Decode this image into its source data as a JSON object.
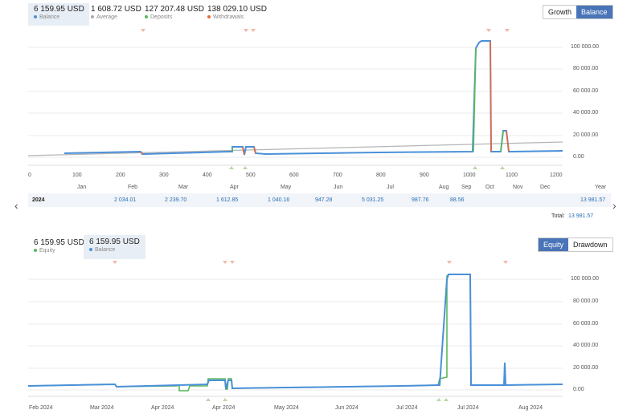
{
  "top_stats": [
    {
      "value": "6 159.95 USD",
      "label": "Balance",
      "color": "#4a90d9"
    },
    {
      "value": "1 608.72 USD",
      "label": "Average",
      "color": "#aaaaaa"
    },
    {
      "value": "127 207.48 USD",
      "label": "Deposits",
      "color": "#5cb85c"
    },
    {
      "value": "138 029.10 USD",
      "label": "Withdrawals",
      "color": "#e8663d"
    }
  ],
  "top_toggle": {
    "growth": "Growth",
    "balance": "Balance",
    "selected": "Balance"
  },
  "chart1": {
    "x_ticks": [
      "0",
      "100",
      "200",
      "300",
      "400",
      "500",
      "600",
      "700",
      "800",
      "900",
      "1000",
      "1100",
      "1200"
    ],
    "y_ticks": [
      "100 000.00",
      "80 000.00",
      "60 000.00",
      "40 000.00",
      "20 000.00",
      "0.00"
    ],
    "months": [
      "Jan",
      "Feb",
      "Mar",
      "Apr",
      "May",
      "Jun",
      "Jul",
      "Aug",
      "Sep",
      "Oct",
      "Nov",
      "Dec"
    ],
    "year_label": "Year"
  },
  "year_row": {
    "year": "2024",
    "values": [
      "2 034.01",
      "2 239.70",
      "1 612.85",
      "1 040.16",
      "947.28",
      "5 031.25",
      "987.76",
      "88.56"
    ],
    "total_year": "13 981.57",
    "total_label": "Total:",
    "total_value": "13 981.57"
  },
  "nav": {
    "prev": "‹",
    "next": "›"
  },
  "bottom_stats": [
    {
      "value": "6 159.95 USD",
      "label": "Equity",
      "color": "#5cb85c"
    },
    {
      "value": "6 159.95 USD",
      "label": "Balance",
      "color": "#4a90d9"
    }
  ],
  "bottom_toggle": {
    "equity": "Equity",
    "drawdown": "Drawdown",
    "selected": "Equity"
  },
  "chart2": {
    "y_ticks": [
      "100 000.00",
      "80 000.00",
      "60 000.00",
      "40 000.00",
      "20 000.00",
      "0.00"
    ],
    "x_labels": [
      "Feb 2024",
      "Mar 2024",
      "Apr 2024",
      "Apr 2024",
      "May 2024",
      "Jun 2024",
      "Jul 2024",
      "Jul 2024",
      "Aug 2024"
    ]
  },
  "colors": {
    "balance": "#4a90d9",
    "equity": "#5cb85c",
    "withdrawal": "#e8663d",
    "average": "#aaaaaa",
    "accent": "#4a74b8"
  },
  "chart_data": [
    {
      "type": "line",
      "title": "",
      "xlabel": "",
      "ylabel": "",
      "xlim": [
        0,
        1200
      ],
      "ylim": [
        0,
        110000
      ],
      "series": [
        {
          "name": "Balance",
          "x": [
            0,
            250,
            250,
            255,
            460,
            460,
            490,
            490,
            495,
            510,
            510,
            520,
            560,
            1005,
            1010,
            1030,
            1050,
            1060,
            1070,
            1075,
            1085,
            1090,
            1200
          ],
          "y": [
            4000,
            5500,
            1500,
            1800,
            5000,
            9500,
            9500,
            3000,
            9500,
            9500,
            5500,
            3000,
            3500,
            6000,
            100000,
            105000,
            105000,
            5500,
            5500,
            25000,
            25000,
            5000,
            6160
          ]
        },
        {
          "name": "Average",
          "x": [
            0,
            1200
          ],
          "y": [
            0,
            13500
          ]
        }
      ]
    },
    {
      "type": "line",
      "title": "",
      "xlabel": "",
      "ylabel": "",
      "ylim": [
        0,
        110000
      ],
      "series": [
        {
          "name": "Equity",
          "x": [
            0,
            0.16,
            0.165,
            0.27,
            0.28,
            0.295,
            0.33,
            0.335,
            0.36,
            0.365,
            0.42,
            0.76,
            0.77,
            0.78,
            0.79,
            0.83,
            0.835,
            0.89,
            0.891,
            0.893,
            1
          ],
          "y": [
            4000,
            5500,
            1500,
            4000,
            0,
            0,
            9500,
            9500,
            0,
            9500,
            1500,
            5500,
            10000,
            105000,
            105000,
            105000,
            5000,
            5000,
            26000,
            5000,
            6160
          ]
        },
        {
          "name": "Balance",
          "x": [
            0,
            0.16,
            0.165,
            0.33,
            0.335,
            0.36,
            0.365,
            0.42,
            0.76,
            0.77,
            0.78,
            0.79,
            0.83,
            0.835,
            0.89,
            0.891,
            0.893,
            1
          ],
          "y": [
            4000,
            5500,
            1500,
            4500,
            9000,
            9000,
            1500,
            1500,
            5500,
            5500,
            100000,
            105000,
            105000,
            5000,
            5000,
            26000,
            5000,
            6160
          ]
        }
      ]
    }
  ]
}
